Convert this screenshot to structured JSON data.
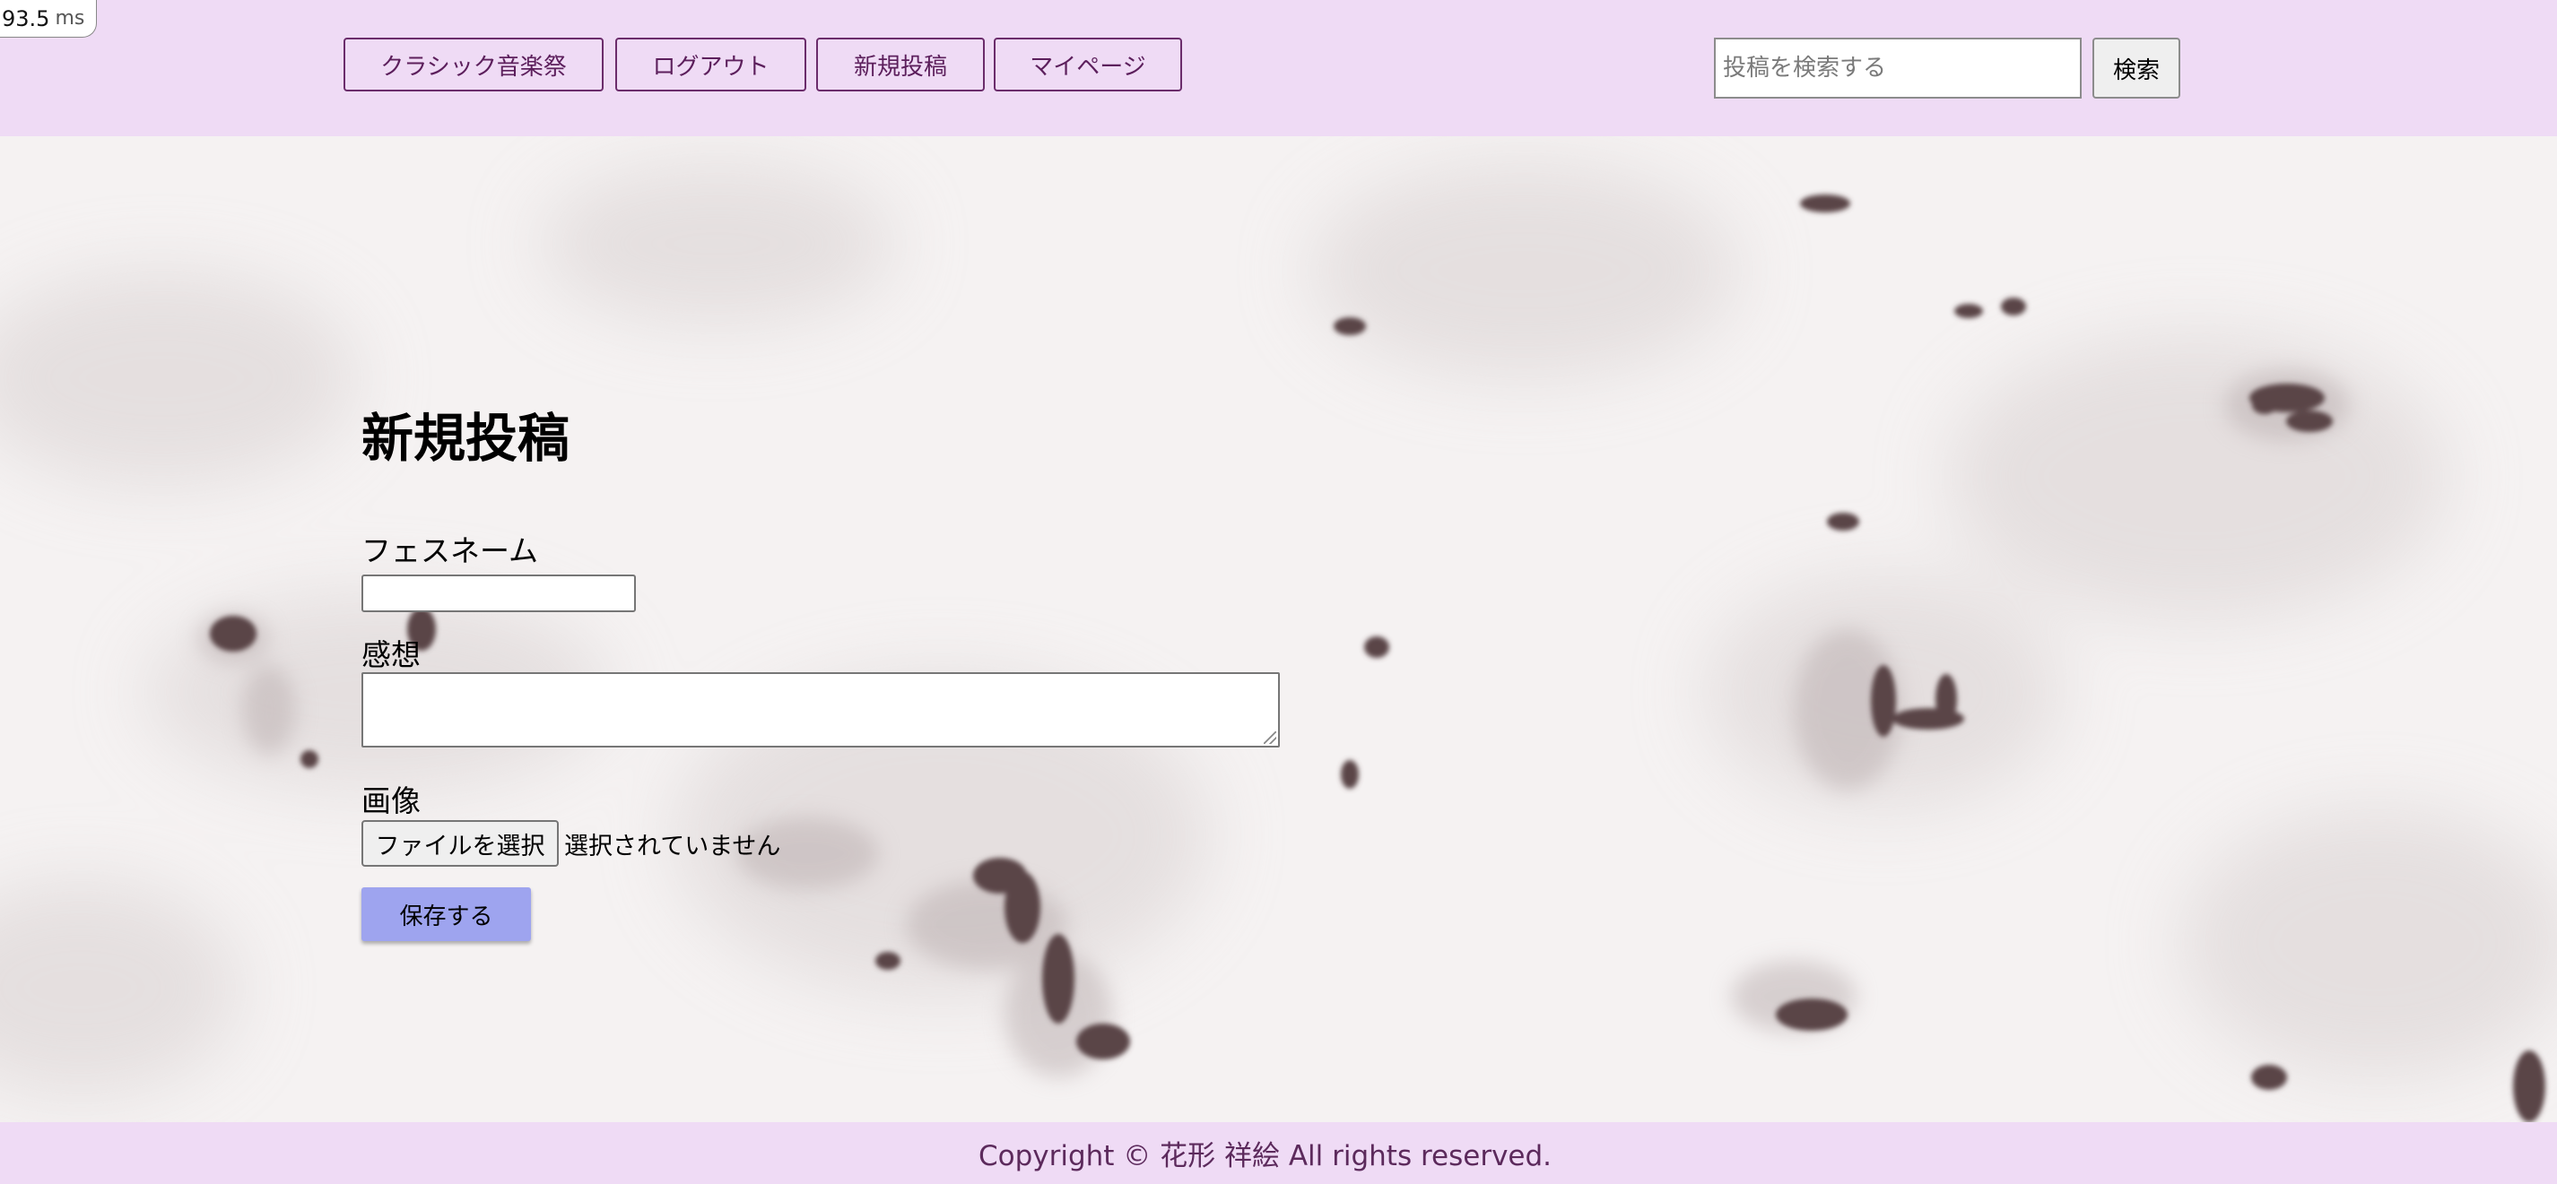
{
  "perf": {
    "value": "93.5",
    "unit": "ms"
  },
  "header": {
    "nav": [
      {
        "label": "クラシック音楽祭"
      },
      {
        "label": "ログアウト"
      },
      {
        "label": "新規投稿"
      },
      {
        "label": "マイページ"
      }
    ],
    "search": {
      "placeholder": "投稿を検索する",
      "value": "",
      "button_label": "検索"
    }
  },
  "main": {
    "title": "新規投稿",
    "fields": {
      "fes_name": {
        "label": "フェスネーム",
        "value": ""
      },
      "impression": {
        "label": "感想",
        "value": ""
      },
      "image": {
        "label": "画像",
        "button_label": "ファイルを選択",
        "status": "選択されていません"
      }
    },
    "save_label": "保存する"
  },
  "footer": {
    "copyright": "Copyright © 花形 祥絵 All rights reserved."
  },
  "colors": {
    "header_bg": "#efdbf5",
    "nav_border": "#6b2c6b",
    "save_button": "#9ea4ef",
    "footer_text": "#5c2a5c"
  },
  "icons": [
    "textarea-resize-grip"
  ]
}
